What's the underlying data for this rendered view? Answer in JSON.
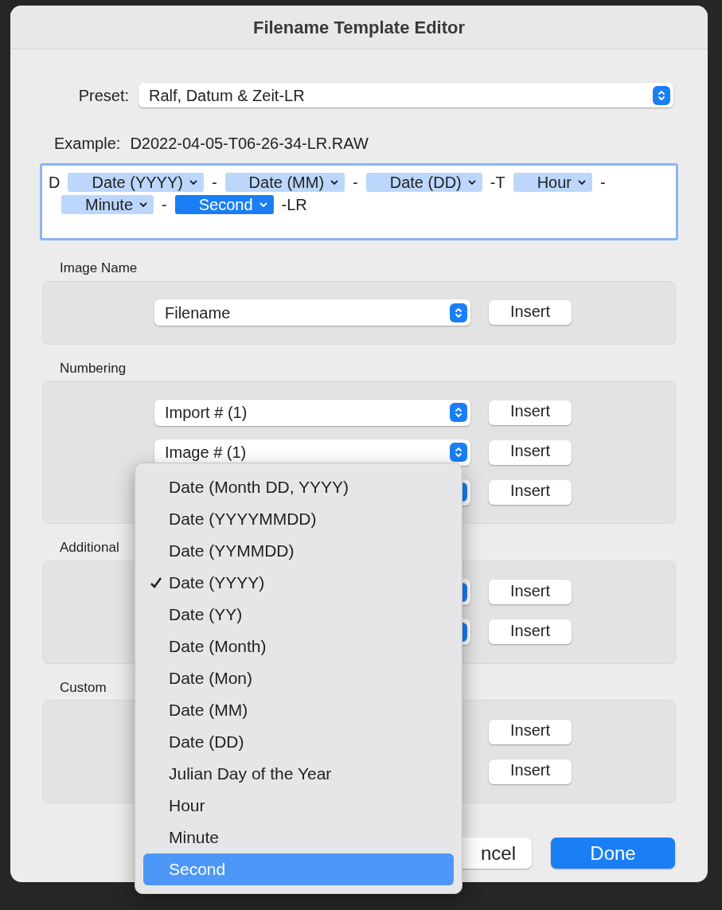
{
  "window": {
    "title": "Filename Template Editor"
  },
  "preset": {
    "label": "Preset:",
    "value": "Ralf, Datum & Zeit-LR"
  },
  "example": {
    "label": "Example:",
    "value": "D2022-04-05-T06-26-34-LR.RAW"
  },
  "template": [
    {
      "kind": "text",
      "text": "D"
    },
    {
      "kind": "token",
      "text": "Date (YYYY)",
      "selected": false
    },
    {
      "kind": "text",
      "text": "-"
    },
    {
      "kind": "token",
      "text": "Date (MM)",
      "selected": false
    },
    {
      "kind": "text",
      "text": "-"
    },
    {
      "kind": "token",
      "text": "Date (DD)",
      "selected": false
    },
    {
      "kind": "text",
      "text": "-T"
    },
    {
      "kind": "token",
      "text": "Hour",
      "selected": false
    },
    {
      "kind": "text",
      "text": "-"
    },
    {
      "kind": "break"
    },
    {
      "kind": "token",
      "text": "Minute",
      "selected": false
    },
    {
      "kind": "text",
      "text": "-"
    },
    {
      "kind": "token",
      "text": "Second",
      "selected": true
    },
    {
      "kind": "text",
      "text": "-LR"
    }
  ],
  "sections": [
    {
      "title": "Image Name",
      "rows": [
        {
          "kind": "select",
          "value": "Filename",
          "button": "Insert"
        }
      ]
    },
    {
      "title": "Numbering",
      "rows": [
        {
          "kind": "select",
          "value": "Import # (1)",
          "button": "Insert"
        },
        {
          "kind": "select",
          "value": "Image # (1)",
          "button": "Insert"
        },
        {
          "kind": "select",
          "button": "Insert"
        }
      ]
    },
    {
      "title": "Additional",
      "rows": [
        {
          "kind": "select",
          "button": "Insert"
        },
        {
          "kind": "select",
          "button": "Insert"
        }
      ]
    },
    {
      "title": "Custom",
      "rows": [
        {
          "button": "Insert"
        },
        {
          "button": "Insert"
        }
      ]
    }
  ],
  "buttons": [
    {
      "label": "ncel",
      "kind": "secondary"
    },
    {
      "label": "Done",
      "kind": "primary"
    }
  ],
  "menu": [
    {
      "label": "Date (Month DD, YYYY)",
      "checked": false,
      "selected": false
    },
    {
      "label": "Date (YYYYMMDD)",
      "checked": false,
      "selected": false
    },
    {
      "label": "Date (YYMMDD)",
      "checked": false,
      "selected": false
    },
    {
      "label": "Date (YYYY)",
      "checked": true,
      "selected": false
    },
    {
      "label": "Date (YY)",
      "checked": false,
      "selected": false
    },
    {
      "label": "Date (Month)",
      "checked": false,
      "selected": false
    },
    {
      "label": "Date (Mon)",
      "checked": false,
      "selected": false
    },
    {
      "label": "Date (MM)",
      "checked": false,
      "selected": false
    },
    {
      "label": "Date (DD)",
      "checked": false,
      "selected": false
    },
    {
      "label": "Julian Day of the Year",
      "checked": false,
      "selected": false
    },
    {
      "label": "Hour",
      "checked": false,
      "selected": false
    },
    {
      "label": "Minute",
      "checked": false,
      "selected": false
    },
    {
      "label": "Second",
      "checked": false,
      "selected": true
    }
  ]
}
